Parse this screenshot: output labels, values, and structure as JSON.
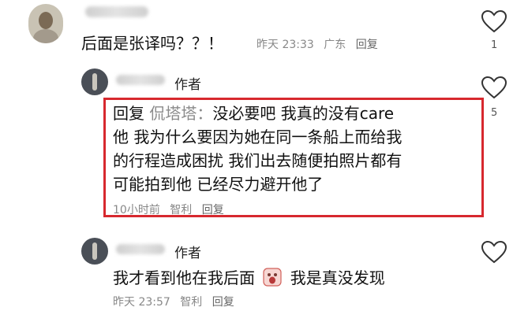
{
  "comments": [
    {
      "username": "",
      "text": "后面是张译吗？？！",
      "meta": {
        "time": "昨天 23:33",
        "location": "广东",
        "reply": "回复"
      },
      "likes": "1"
    },
    {
      "author_tag": "作者",
      "reply_prefix": "回复",
      "reply_target": "侃塔塔：",
      "lines": [
        "没必要吧 我真的没有care",
        "他 我为什么要因为她在同一条船上而给我",
        "的行程造成困扰 我们出去随便拍照片都有",
        "可能拍到他 已经尽力避开他了"
      ],
      "meta": {
        "time": "10小时前",
        "location": "智利",
        "reply": "回复"
      },
      "likes": "5"
    },
    {
      "author_tag": "作者",
      "text_before": "我才看到他在我后面",
      "emoji": "😱",
      "text_after": "我是真没发现",
      "meta": {
        "time": "昨天 23:57",
        "location": "智利",
        "reply": "回复"
      }
    }
  ],
  "colors": {
    "highlight": "#d7282e",
    "meta_text": "#888888"
  },
  "icons": [
    "heart-outline-icon",
    "avatar-icon",
    "scream-emoji-icon"
  ]
}
